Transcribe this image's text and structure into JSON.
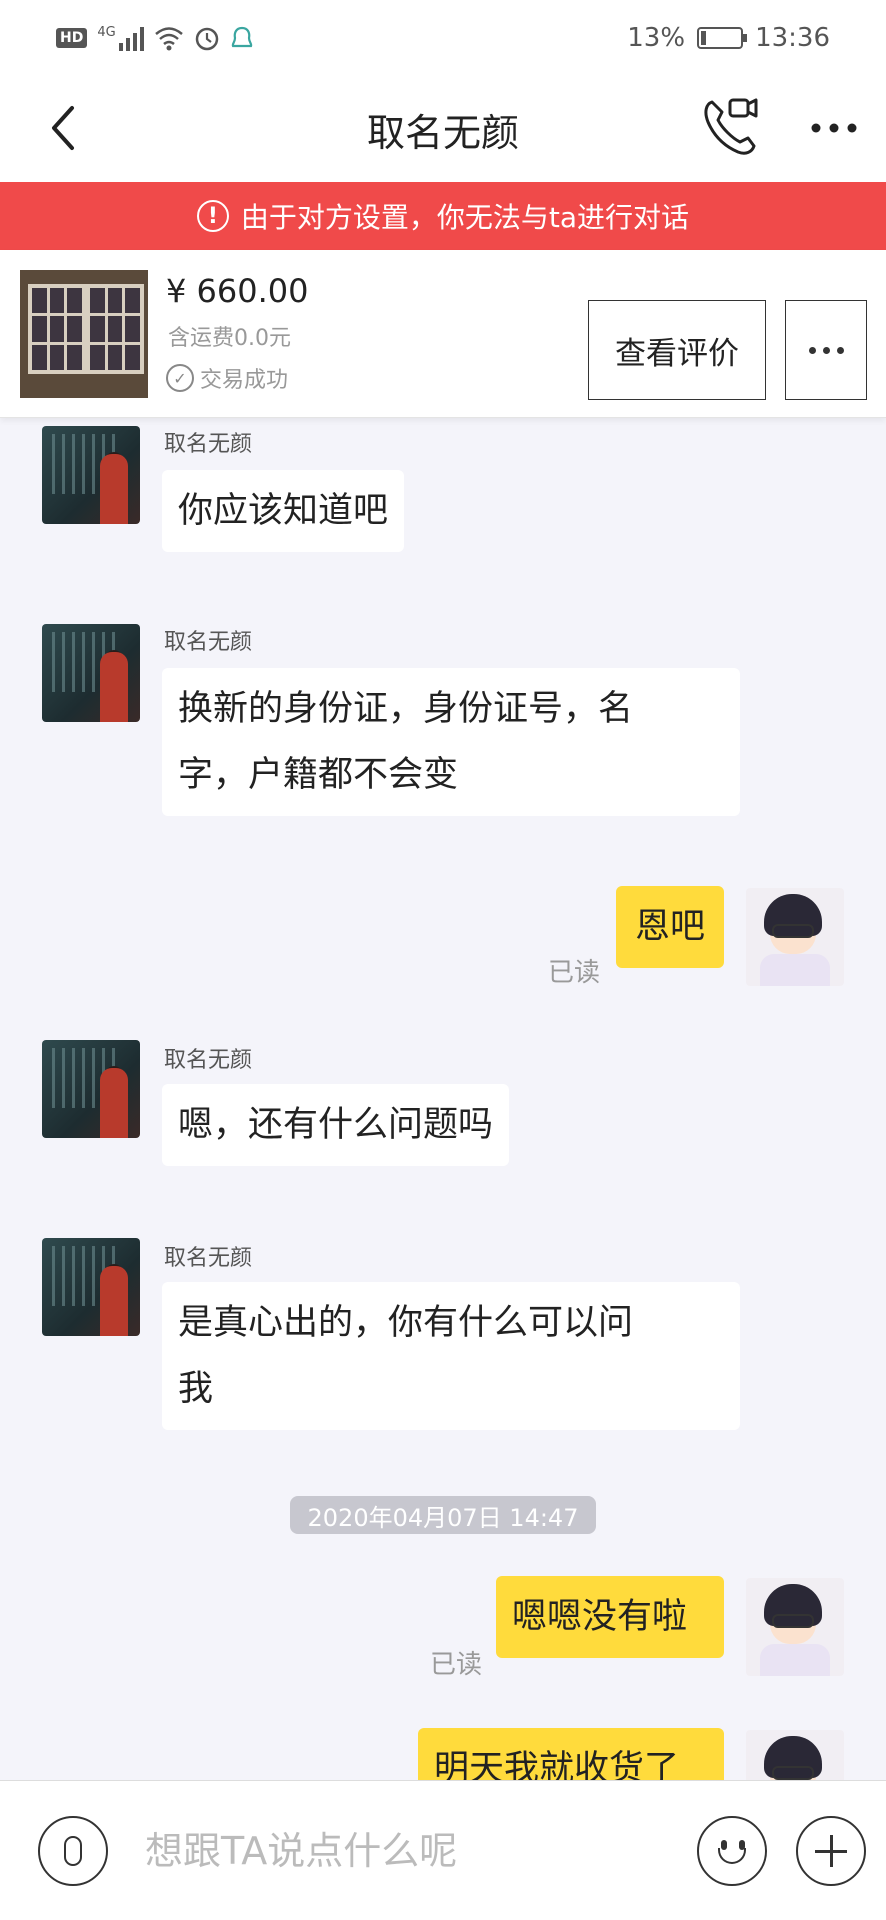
{
  "status_bar": {
    "network": "4G",
    "hd": "HD",
    "battery_percent": "13%",
    "battery_level": 0.13,
    "time": "13:36"
  },
  "header": {
    "title": "取名无颜"
  },
  "banner": {
    "icon": "!",
    "text": "由于对方设置，你无法与ta进行对话"
  },
  "product": {
    "price": "¥ 660.00",
    "shipping": "含运费0.0元",
    "status": "交易成功",
    "review_label": "查看评价"
  },
  "messages": [
    {
      "side": "peer",
      "sender": "取名无颜",
      "lines": [
        "你应该知道吧"
      ]
    },
    {
      "side": "peer",
      "sender": "取名无颜",
      "lines": [
        "换新的身份证，身份证号，名",
        "字，户籍都不会变"
      ]
    },
    {
      "side": "self",
      "lines": [
        "恩吧"
      ],
      "read": "已读"
    },
    {
      "side": "peer",
      "sender": "取名无颜",
      "lines": [
        "嗯，还有什么问题吗"
      ]
    },
    {
      "side": "peer",
      "sender": "取名无颜",
      "lines": [
        "是真心出的，你有什么可以问",
        "我"
      ]
    },
    {
      "side": "self",
      "lines": [
        "嗯嗯没有啦"
      ],
      "read": "已读"
    },
    {
      "side": "self",
      "lines": [
        "明天我就收货了"
      ]
    }
  ],
  "time_divider": "2020年04月07日 14:47",
  "composer": {
    "placeholder": "想跟TA说点什么呢"
  },
  "colors": {
    "banner": "#f04a4a",
    "self_bubble": "#ffdb3c",
    "peer_bubble": "#ffffff",
    "background": "#f4f4fa"
  },
  "icons": [
    "hd-icon",
    "signal-icon",
    "wifi-icon",
    "alarm-icon",
    "notify-icon",
    "battery-icon",
    "back-icon",
    "video-call-icon",
    "more-icon",
    "warning-icon",
    "check-icon",
    "mic-icon",
    "emoji-icon",
    "plus-icon"
  ]
}
